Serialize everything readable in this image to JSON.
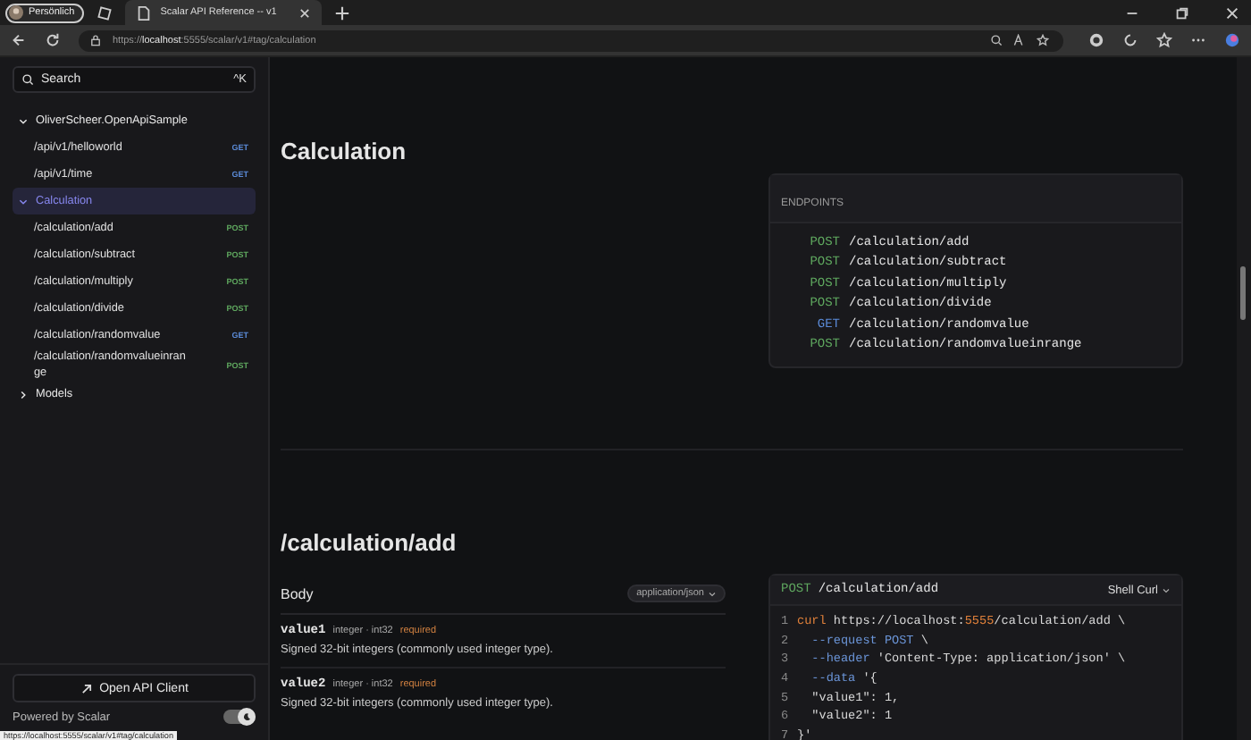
{
  "browser": {
    "profile": "Persönlich",
    "tab_title": "Scalar API Reference -- v1",
    "url": {
      "scheme": "https://",
      "host": "localhost",
      "rest": ":5555/scalar/v1#tag/calculation"
    }
  },
  "sidebar": {
    "search": {
      "placeholder": "Search",
      "shortcut": "^K"
    },
    "tree": [
      {
        "label": "OliverScheer.OpenApiSample",
        "expanded": true,
        "selected": false,
        "children": [
          {
            "label": "/api/v1/helloworld",
            "method": "GET"
          },
          {
            "label": "/api/v1/time",
            "method": "GET"
          }
        ]
      },
      {
        "label": "Calculation",
        "expanded": true,
        "selected": true,
        "children": [
          {
            "label": "/calculation/add",
            "method": "POST"
          },
          {
            "label": "/calculation/subtract",
            "method": "POST"
          },
          {
            "label": "/calculation/multiply",
            "method": "POST"
          },
          {
            "label": "/calculation/divide",
            "method": "POST"
          },
          {
            "label": "/calculation/randomvalue",
            "method": "GET"
          },
          {
            "label": "/calculation/randomvalueinrange",
            "method": "POST"
          }
        ]
      },
      {
        "label": "Models",
        "expanded": false,
        "selected": false
      }
    ],
    "open_client": "Open API Client",
    "powered_by": "Powered by Scalar",
    "dark_mode": {
      "on": true
    }
  },
  "status_tooltip": "https://localhost:5555/scalar/v1#tag/calculation",
  "tag": {
    "title": "Calculation",
    "endpoints_label": "ENDPOINTS",
    "endpoints": [
      {
        "method": "POST",
        "path": "/calculation/add"
      },
      {
        "method": "POST",
        "path": "/calculation/subtract"
      },
      {
        "method": "POST",
        "path": "/calculation/multiply"
      },
      {
        "method": "POST",
        "path": "/calculation/divide"
      },
      {
        "method": "GET",
        "path": "/calculation/randomvalue"
      },
      {
        "method": "POST",
        "path": "/calculation/randomvalueinrange"
      }
    ]
  },
  "operation": {
    "title": "/calculation/add",
    "body_label": "Body",
    "content_type": "application/json",
    "params": [
      {
        "name": "value1",
        "type": "integer · int32",
        "required": "required",
        "description": "Signed 32-bit integers (commonly used integer type)."
      },
      {
        "name": "value2",
        "type": "integer · int32",
        "required": "required",
        "description": "Signed 32-bit integers (commonly used integer type)."
      }
    ],
    "example": {
      "method": "POST",
      "path": "/calculation/add",
      "client": "Shell Curl",
      "lines": [
        {
          "number": "1",
          "tokens": [
            {
              "kind": "command",
              "text": "curl"
            },
            {
              "kind": "plain",
              "text": " https://localhost:"
            },
            {
              "kind": "number",
              "text": "5555"
            },
            {
              "kind": "plain",
              "text": "/calculation/add \\"
            }
          ]
        },
        {
          "number": "2",
          "tokens": [
            {
              "kind": "flag",
              "text": "  --request POST"
            },
            {
              "kind": "plain",
              "text": " \\"
            }
          ]
        },
        {
          "number": "3",
          "tokens": [
            {
              "kind": "flag",
              "text": "  --header"
            },
            {
              "kind": "plain",
              "text": " 'Content-Type: application/json' \\"
            }
          ]
        },
        {
          "number": "4",
          "tokens": [
            {
              "kind": "flag",
              "text": "  --data"
            },
            {
              "kind": "plain",
              "text": " '{"
            }
          ]
        },
        {
          "number": "5",
          "tokens": [
            {
              "kind": "plain",
              "text": "  \"value1\": 1,"
            }
          ]
        },
        {
          "number": "6",
          "tokens": [
            {
              "kind": "plain",
              "text": "  \"value2\": 1"
            }
          ]
        },
        {
          "number": "7",
          "tokens": [
            {
              "kind": "plain",
              "text": "}'"
            }
          ]
        }
      ]
    }
  }
}
